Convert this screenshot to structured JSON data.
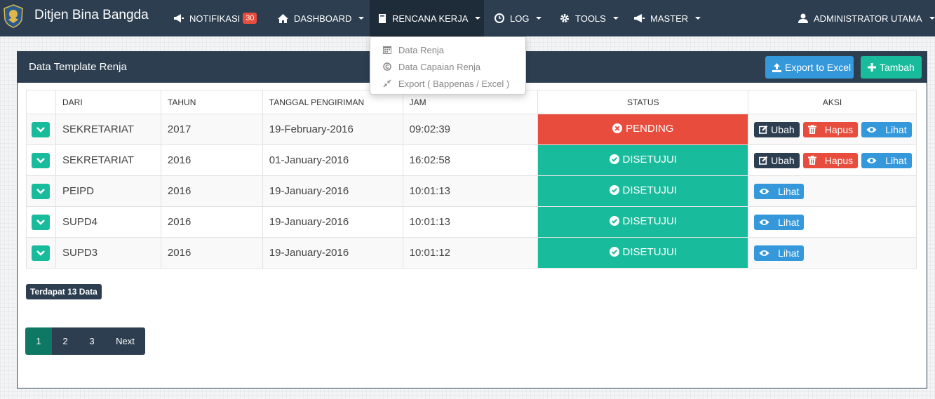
{
  "navbar": {
    "brand": "Ditjen Bina Bangda",
    "notifikasi": "NOTIFIKASI",
    "notif_count": "30",
    "dashboard": "DASHBOARD",
    "rencana_kerja": "RENCANA KERJA",
    "log": "LOG",
    "tools": "TOOLS",
    "master": "MASTER",
    "user": "ADMINISTRATOR UTAMA"
  },
  "dropdown": {
    "items": [
      "Data Renja",
      "Data Capaian Renja",
      "Export ( Bappenas / Excel )"
    ],
    "icons": [
      "calendar-icon",
      "copyright-icon",
      "compress-icon"
    ]
  },
  "panel": {
    "title": "Data Template Renja",
    "export_label": "Export to Excel",
    "add_label": "Tambah"
  },
  "table": {
    "headers": [
      "DARI",
      "TAHUN",
      "TANGGAL PENGIRIMAN",
      "JAM",
      "STATUS",
      "AKSI"
    ],
    "rows": [
      {
        "dari": "SEKRETARIAT",
        "tahun": "2017",
        "tanggal": "19-February-2016",
        "jam": "09:02:39",
        "status": "PENDING"
      },
      {
        "dari": "SEKRETARIAT",
        "tahun": "2016",
        "tanggal": "01-January-2016",
        "jam": "16:02:58",
        "status": "DISETUJUI"
      },
      {
        "dari": "PEIPD",
        "tahun": "2016",
        "tanggal": "19-January-2016",
        "jam": "10:01:13",
        "status": "DISETUJUI"
      },
      {
        "dari": "SUPD4",
        "tahun": "2016",
        "tanggal": "19-January-2016",
        "jam": "10:01:13",
        "status": "DISETUJUI"
      },
      {
        "dari": "SUPD3",
        "tahun": "2016",
        "tanggal": "19-January-2016",
        "jam": "10:01:12",
        "status": "DISETUJUI"
      }
    ],
    "actions": {
      "edit": "Ubah",
      "delete": "Hapus",
      "view": "Lihat"
    }
  },
  "footer": {
    "count_label": "Terdapat 13 Data",
    "pages": [
      "1",
      "2",
      "3"
    ],
    "next": "Next"
  },
  "colors": {
    "navbar": "#2c3e50",
    "success": "#18bc9c",
    "danger": "#e74c3c",
    "info": "#3498db"
  }
}
